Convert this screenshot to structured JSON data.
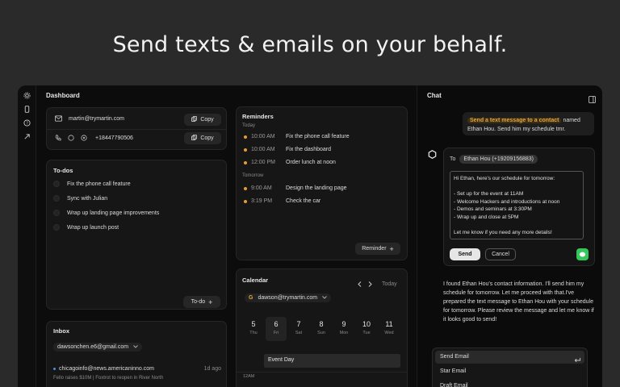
{
  "headline": "Send texts & emails on your behalf.",
  "dashboard": {
    "title": "Dashboard",
    "contact": {
      "email": "martin@trymartin.com",
      "phone": "+18447790506",
      "copy_label": "Copy"
    },
    "todos": {
      "title": "To-dos",
      "items": [
        "Fix the phone call feature",
        "Sync with Julian",
        "Wrap up landing page improvements",
        "Wrap up launch post"
      ],
      "add_label": "To-do"
    },
    "reminders": {
      "title": "Reminders",
      "today_label": "Today",
      "today": [
        {
          "time": "10:00 AM",
          "text": "Fix the phone call feature"
        },
        {
          "time": "10:00 AM",
          "text": "Fix the dashboard"
        },
        {
          "time": "12:00 PM",
          "text": "Order lunch at noon"
        }
      ],
      "tomorrow_label": "Tomorrow",
      "tomorrow": [
        {
          "time": "9:00 AM",
          "text": "Design the landing page"
        },
        {
          "time": "3:19 PM",
          "text": "Check the car"
        }
      ],
      "add_label": "Reminder"
    },
    "inbox": {
      "title": "Inbox",
      "account": "dawsonchen.e6@gmail.com",
      "items": [
        {
          "from": "chicagoinfo@news.americaninno.com",
          "age": "1d ago",
          "preview": "Fello raises $10M | Foxtrot to reopen in River North"
        }
      ]
    },
    "calendar": {
      "title": "Calendar",
      "today_label": "Today",
      "account": "dawson@trymartin.com",
      "days": [
        {
          "num": "5",
          "dow": "Thu"
        },
        {
          "num": "6",
          "dow": "Fri"
        },
        {
          "num": "7",
          "dow": "Sat"
        },
        {
          "num": "8",
          "dow": "Sun"
        },
        {
          "num": "9",
          "dow": "Mon"
        },
        {
          "num": "10",
          "dow": "Tue"
        },
        {
          "num": "11",
          "dow": "Wed"
        }
      ],
      "event": "Event Day",
      "hour_label": "12AM"
    }
  },
  "chat": {
    "title": "Chat",
    "user_msg_highlight": "Send a text message to a contact",
    "user_msg_rest_1": "named",
    "user_msg_rest_2": "Ethan Hou. Send him my schedule tmr.",
    "to_label": "To",
    "to_value": "Ethan Hou (+19209156883)",
    "draft_lines": [
      "Hi Ethan, here's our schedule for tomorrow:",
      "",
      "- Set up for the event at 11AM",
      "- Welcome Hackers and introductions at noon",
      "- Demos and seminars at 3:30PM",
      "- Wrap up and close at 5PM",
      "",
      "Let me know if you need any more details!"
    ],
    "send_label": "Send",
    "cancel_label": "Cancel",
    "assistant_msg": "I found Ethan Hou's contact information. I'll send him my schedule for tomorrow. Let me proceed with that.I've prepared the text message to Ethan Hou with your schedule for tomorrow. Please review the message and let me know if it looks good to send!",
    "menu": [
      "Send Email",
      "Star Email",
      "Draft Email"
    ],
    "accent": "#e0a030"
  }
}
